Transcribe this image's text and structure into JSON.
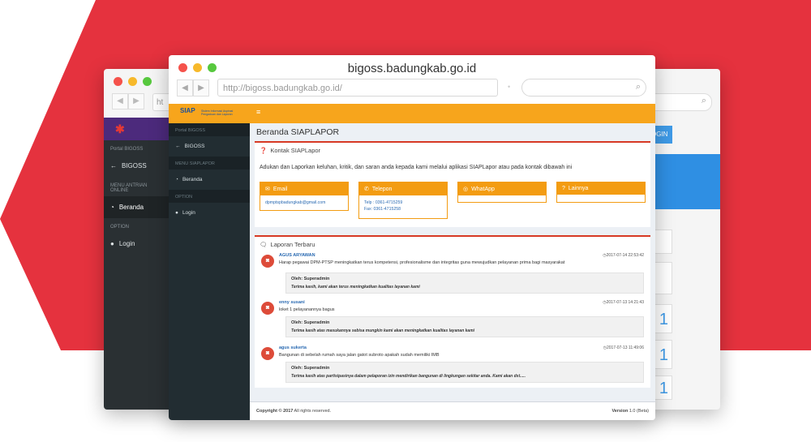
{
  "colors": {
    "accent_red": "#e5323e",
    "orange": "#f7a51c",
    "sidebar": "#222d32"
  },
  "back_window": {
    "url_fragment": "ht",
    "brand_text": "",
    "sidebar": {
      "section1": "Portal BIGOSS",
      "item1": "BIGOSS",
      "section2": "MENU ANTRIAN ONLINE",
      "item2": "Beranda",
      "section3": "OPTION",
      "item3": "Login"
    },
    "login_button": "LOGIN",
    "card_digits": [
      "1",
      "1",
      "1"
    ]
  },
  "front_window": {
    "title": "bigoss.badungkab.go.id",
    "url": "http://bigoss.badungkab.go.id/",
    "logo_mark": "SIAP",
    "logo_sub": "Sistem Informasi Aspirasi Pengaduan dan Laporan",
    "sidebar": {
      "section1": "Portal BIGOSS",
      "item1": "BIGOSS",
      "section2": "MENU SIAPLAPOR",
      "item2": "Beranda",
      "section3": "OPTION",
      "item3": "Login"
    },
    "menu_icon": "≡",
    "page_title": "Beranda SIAPLAPOR",
    "contact": {
      "heading": "Kontak SIAPLapor",
      "intro": "Adukan dan Laporkan keluhan, kritik, dan saran anda kepada kami melalui aplikasi SIAPLapor atau pada kontak dibawah ini",
      "boxes": [
        {
          "icon": "envelope-icon",
          "label": "Email",
          "line1": "dpmptspbadungkab@gmail.com",
          "line2": ""
        },
        {
          "icon": "phone-icon",
          "label": "Telepon",
          "line1": "Telp : 0361-4715259",
          "line2": "Fax: 0361-4715258"
        },
        {
          "icon": "whatsapp-icon",
          "label": "WhatApp",
          "line1": "",
          "line2": ""
        },
        {
          "icon": "question-icon",
          "label": "Lainnya",
          "line1": "",
          "line2": ""
        }
      ]
    },
    "reports": {
      "heading": "Laporan Terbaru",
      "items": [
        {
          "name": "AGUS ARYAWAN",
          "time": "2017-07-14 22:53:42",
          "message": "Harap pegawai DPM-PTSP meningkatkan terus kompetensi, profesionalisme dan integritas guna mewujudkan pelayanan prima bagi masyarakat",
          "reply_by": "Oleh: Superadmin",
          "reply": "Terima kasih, kami akan terus meningkatkan kualitas layanan kami"
        },
        {
          "name": "enny susani",
          "time": "2017-07-13 14:21:43",
          "message": "loket 1 pelayanannya bagus",
          "reply_by": "Oleh: Superadmin",
          "reply": "Terima kasih atas masukannya sebisa mungkin kami akan meningkatkan kualitas layanan kami"
        },
        {
          "name": "agus sukerta",
          "time": "2017-07-13 11:49:06",
          "message": "Bangunan di sebelah rumah saya jalan gatot subroto apakah sudah memiliki IMB",
          "reply_by": "Oleh: Superadmin",
          "reply": "Terima kasih atas partisipasinya dalam pelaporan izin mendirikan bangunan di lingkungan sekitar anda. Kami akan dst....."
        }
      ]
    },
    "footer": {
      "copyright_bold": "Copyright © 2017",
      "copyright_rest": " All rights reserved.",
      "version_bold": "Version",
      "version_rest": " 1.0 (Beta)"
    }
  }
}
